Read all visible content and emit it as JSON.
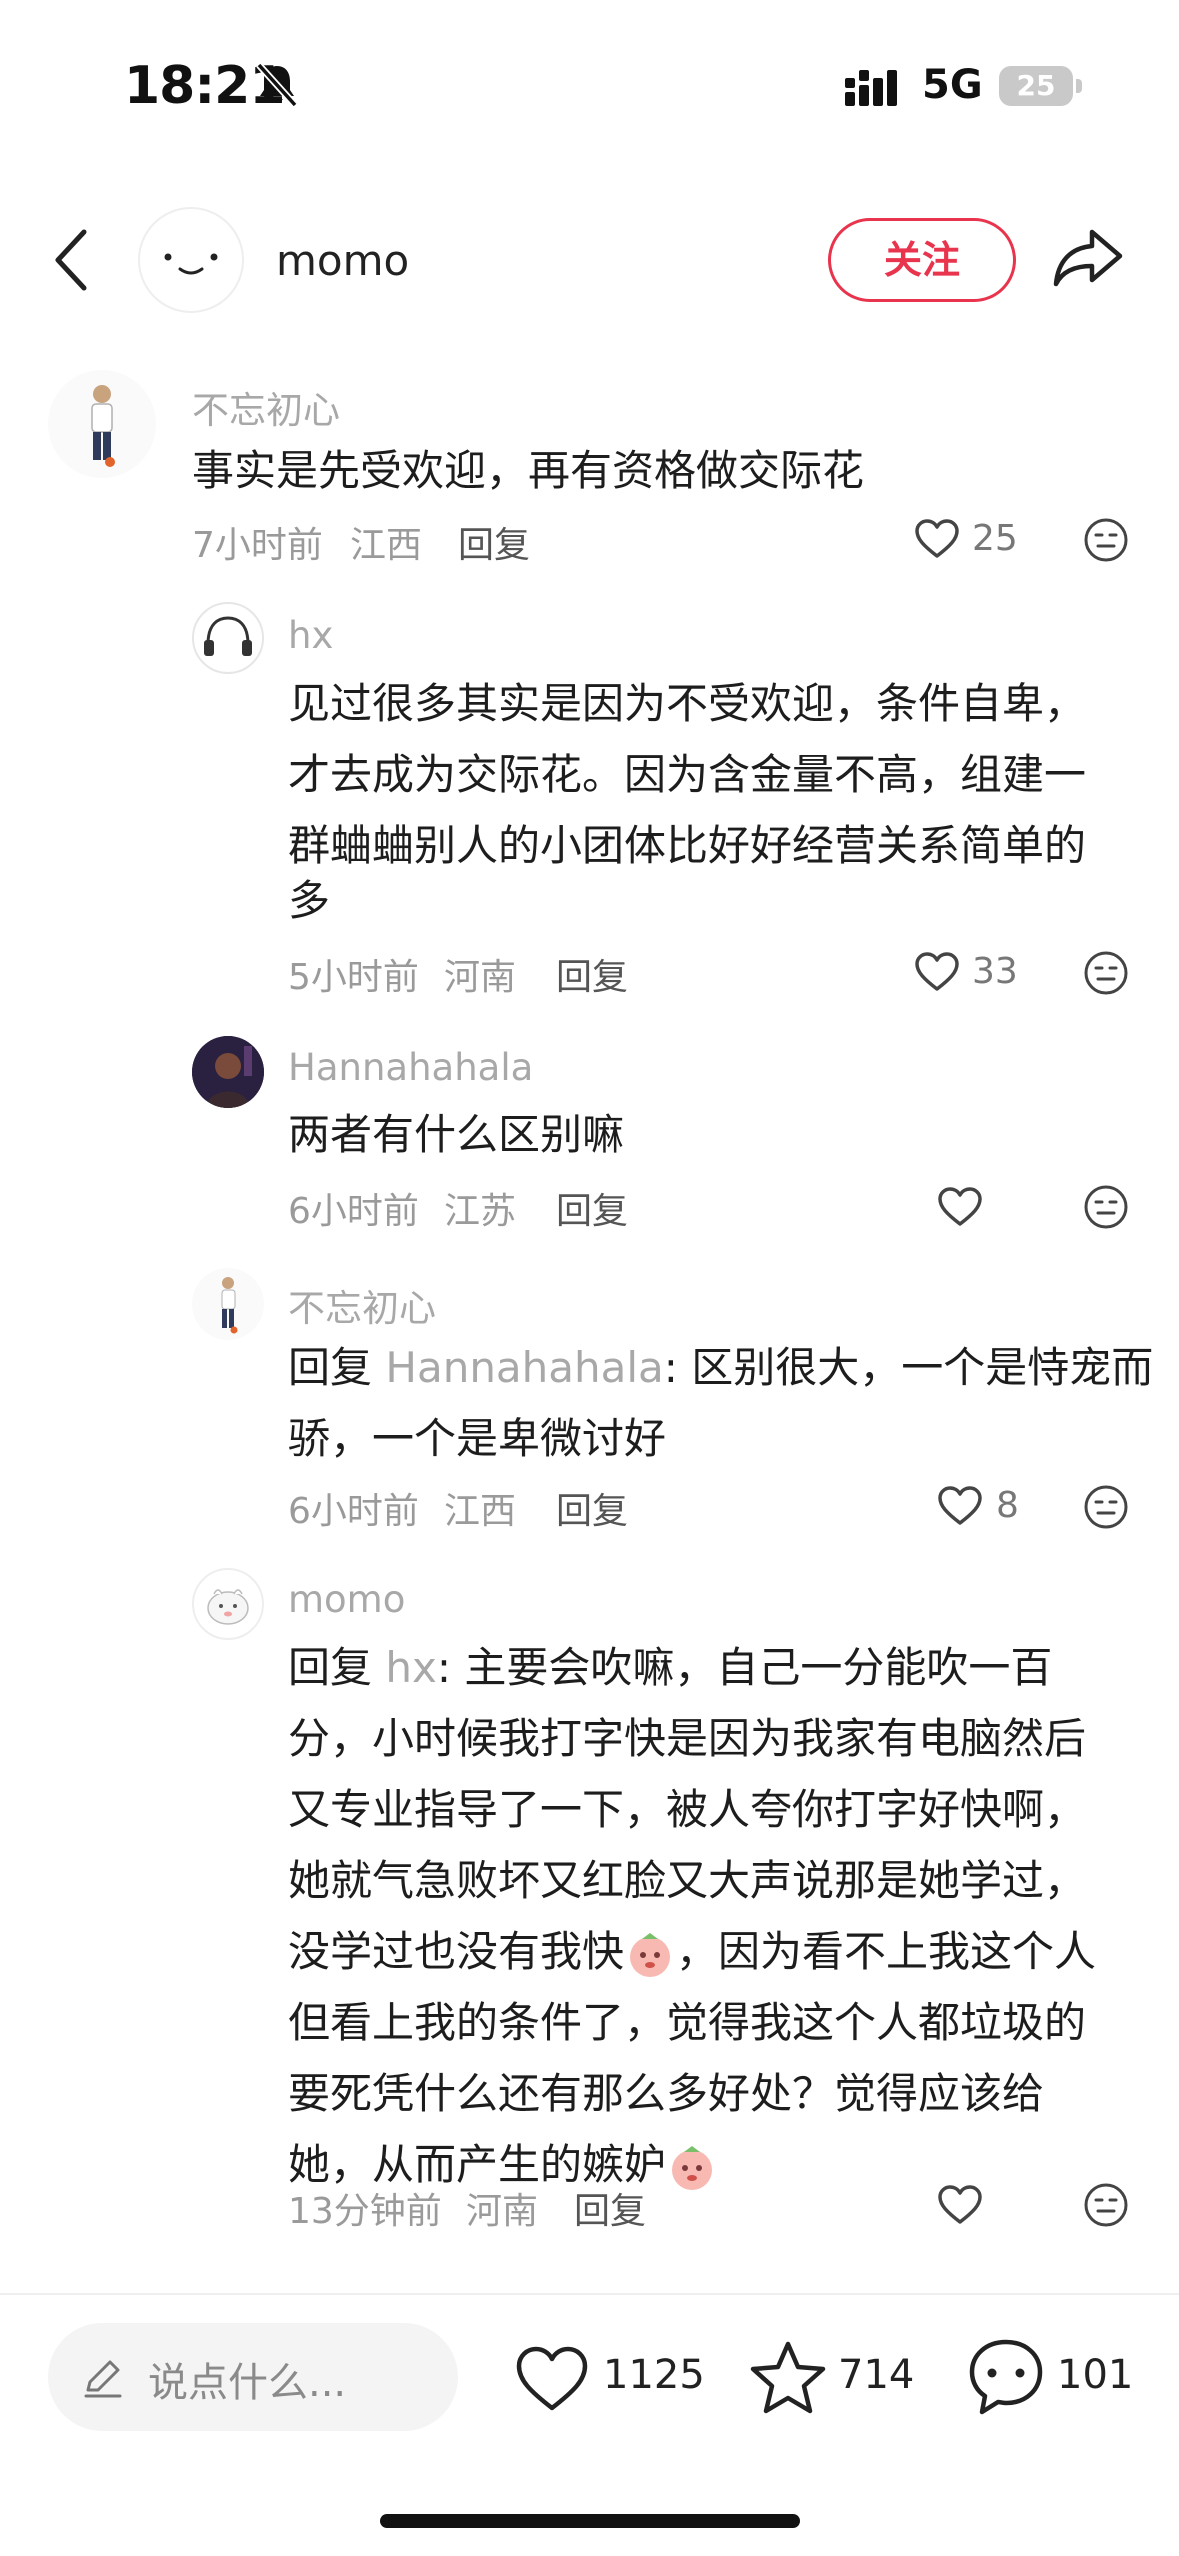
{
  "status": {
    "time": "18:21",
    "network": "5G",
    "battery": "25"
  },
  "header": {
    "author": "momo",
    "follow_label": "关注"
  },
  "comments": [
    {
      "name": "不忘初心",
      "text": "事实是先受欢迎，再有资格做交际花",
      "time": "7小时前",
      "location": "江西",
      "reply": "回复",
      "likes": "25"
    },
    {
      "name": "hx",
      "lines": [
        "见过很多其实是因为不受欢迎，条件自卑，",
        "才去成为交际花。因为含金量不高，组建一",
        "群蛐蛐别人的小团体比好好经营关系简单的",
        "多"
      ],
      "time": "5小时前",
      "location": "河南",
      "reply": "回复",
      "likes": "33"
    },
    {
      "name": "Hannahahala",
      "text": "两者有什么区别嘛",
      "time": "6小时前",
      "location": "江苏",
      "reply": "回复",
      "likes": ""
    },
    {
      "name": "不忘初心",
      "reply_prefix": "回复",
      "reply_to": "Hannahahala",
      "line1": ": 区别很大，一个是恃宠而",
      "line2": "骄，一个是卑微讨好",
      "time": "6小时前",
      "location": "江西",
      "reply": "回复",
      "likes": "8"
    },
    {
      "name": "momo",
      "reply_prefix": "回复",
      "reply_to": "hx",
      "line1": ": 主要会吹嘛，自己一分能吹一百",
      "lines": [
        "分，小时候我打字快是因为我家有电脑然后",
        "又专业指导了一下，被人夸你打字好快啊，",
        "她就气急败坏又红脸又大声说那是她学过，"
      ],
      "line5": "没学过也没有我快",
      "line5b": "，因为看不上我这个人",
      "line6": "但看上我的条件了，觉得我这个人都垃圾的",
      "line7": "要死凭什么还有那么多好处？觉得应该给",
      "line8": "她，从而产生的嫉妒",
      "time": "13分钟前",
      "location": "河南",
      "reply": "回复",
      "likes": ""
    }
  ],
  "bottom": {
    "placeholder": "说点什么...",
    "likes": "1125",
    "stars": "714",
    "comments": "101"
  }
}
